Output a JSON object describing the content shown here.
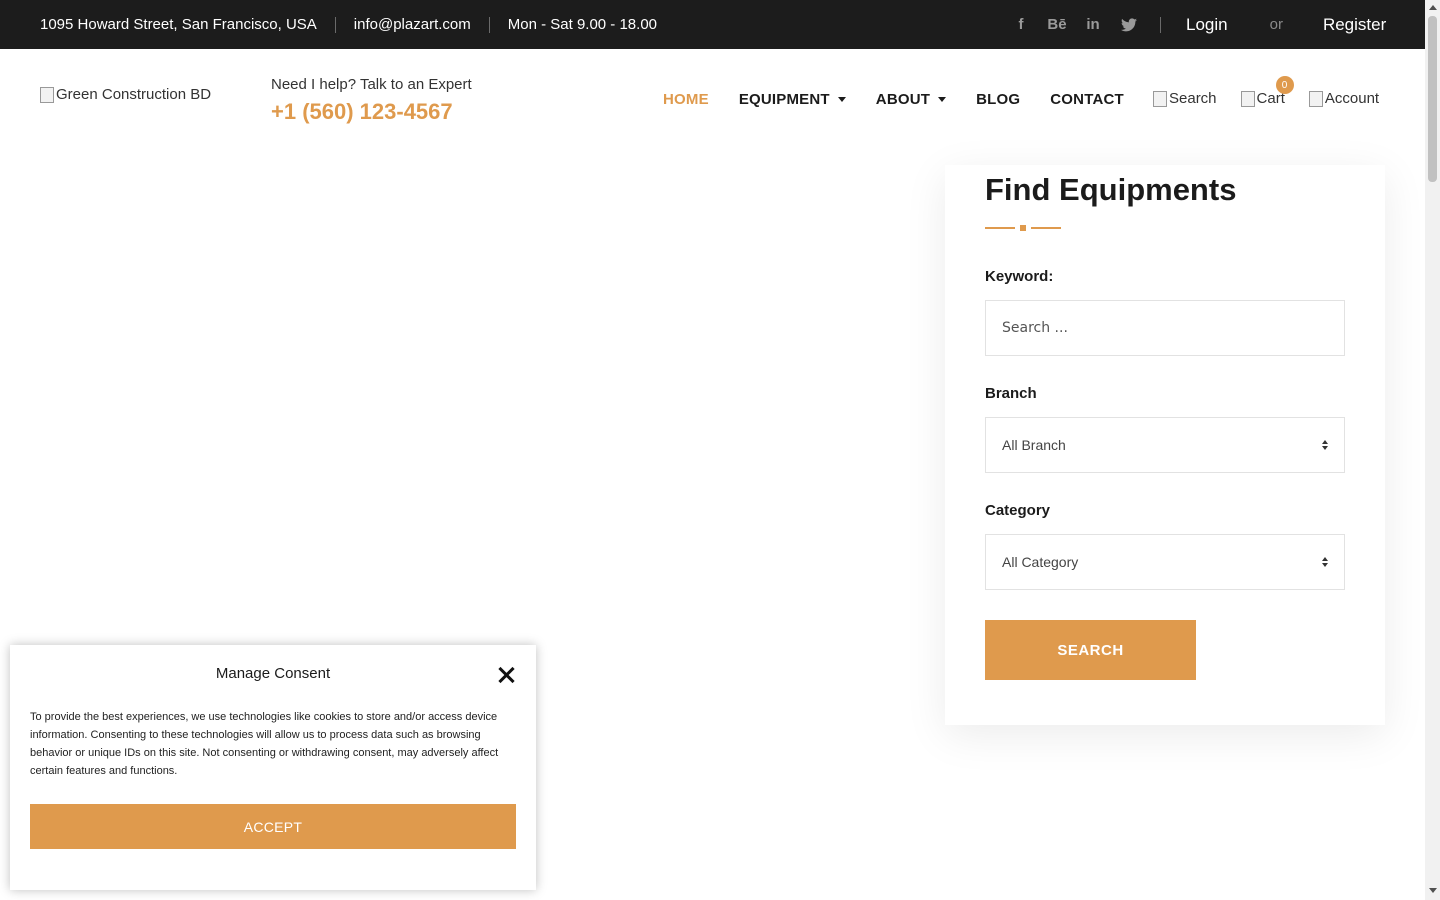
{
  "topbar": {
    "address": "1095 Howard Street, San Francisco, USA",
    "email": "info@plazart.com",
    "hours": "Mon - Sat 9.00 - 18.00",
    "social": [
      {
        "icon": "facebook-icon",
        "glyph": "f"
      },
      {
        "icon": "behance-icon",
        "glyph": "Bē"
      },
      {
        "icon": "linkedin-icon",
        "glyph": "in"
      },
      {
        "icon": "twitter-icon",
        "glyph": "🐦"
      }
    ],
    "login": "Login",
    "or": "or",
    "register": "Register"
  },
  "header": {
    "logo_alt": "Green Construction BD",
    "help_text": "Need I help? Talk to an Expert",
    "phone": "+1 (560) 123-4567",
    "nav": [
      {
        "label": "HOME",
        "active": true,
        "dropdown": false
      },
      {
        "label": "EQUIPMENT",
        "active": false,
        "dropdown": true
      },
      {
        "label": "ABOUT",
        "active": false,
        "dropdown": true
      },
      {
        "label": "BLOG",
        "active": false,
        "dropdown": false
      },
      {
        "label": "CONTACT",
        "active": false,
        "dropdown": false
      }
    ],
    "icons": {
      "search_alt": "Search",
      "cart_alt": "Cart",
      "cart_count": "0",
      "account_alt": "Account"
    }
  },
  "finder": {
    "title": "Find Equipments",
    "keyword_label": "Keyword:",
    "keyword_placeholder": "Search ...",
    "branch_label": "Branch",
    "branch_value": "All Branch",
    "category_label": "Category",
    "category_value": "All Category",
    "search_button": "SEARCH"
  },
  "consent": {
    "title": "Manage Consent",
    "text": "To provide the best experiences, we use technologies like cookies to store and/or access device information. Consenting to these technologies will allow us to process data such as browsing behavior or unique IDs on this site. Not consenting or withdrawing consent, may adversely affect certain features and functions.",
    "accept": "ACCEPT"
  },
  "colors": {
    "accent": "#df9a4d",
    "topbar_bg": "#1c1c1c"
  }
}
